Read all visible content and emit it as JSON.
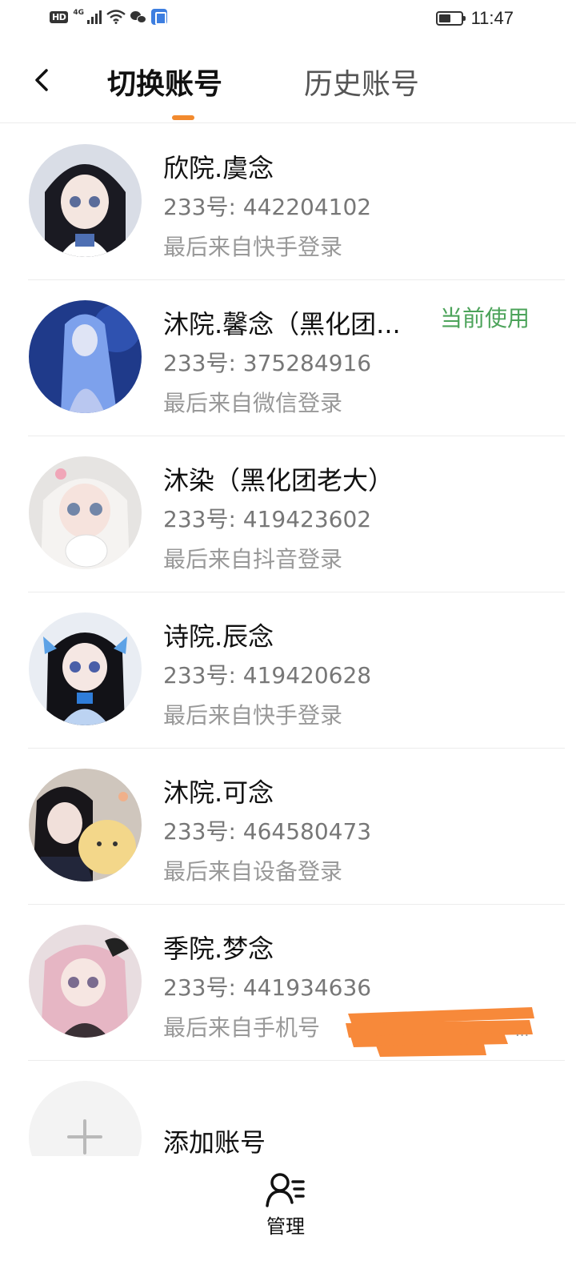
{
  "status_bar": {
    "hd": "HD",
    "network": "4G",
    "time": "11:47"
  },
  "header": {
    "tabs": [
      {
        "label": "切换账号",
        "active": true
      },
      {
        "label": "历史账号",
        "active": false
      }
    ],
    "accent_color": "#f28a2e"
  },
  "accounts": [
    {
      "name": "欣院.虞念",
      "id": "233号: 442204102",
      "login_from": "最后来自快手登录",
      "current_tag": ""
    },
    {
      "name": "沐院.馨念（黑化团...",
      "id": "233号: 375284916",
      "login_from": "最后来自微信登录",
      "current_tag": "当前使用"
    },
    {
      "name": "沐染（黑化团老大）",
      "id": "233号: 419423602",
      "login_from": "最后来自抖音登录",
      "current_tag": ""
    },
    {
      "name": "诗院.辰念",
      "id": "233号: 419420628",
      "login_from": "最后来自快手登录",
      "current_tag": ""
    },
    {
      "name": "沐院.可念",
      "id": "233号: 464580473",
      "login_from": "最后来自设备登录",
      "current_tag": ""
    },
    {
      "name": "季院.梦念",
      "id": "233号: 441934636",
      "login_from": "最后来自手机号",
      "current_tag": ""
    }
  ],
  "redaction_suffix": "...",
  "add_account": {
    "label": "添加账号"
  },
  "bottom": {
    "manage_label": "管理"
  },
  "colors": {
    "current_tag": "#4ca35a",
    "redaction": "#f7893a"
  }
}
